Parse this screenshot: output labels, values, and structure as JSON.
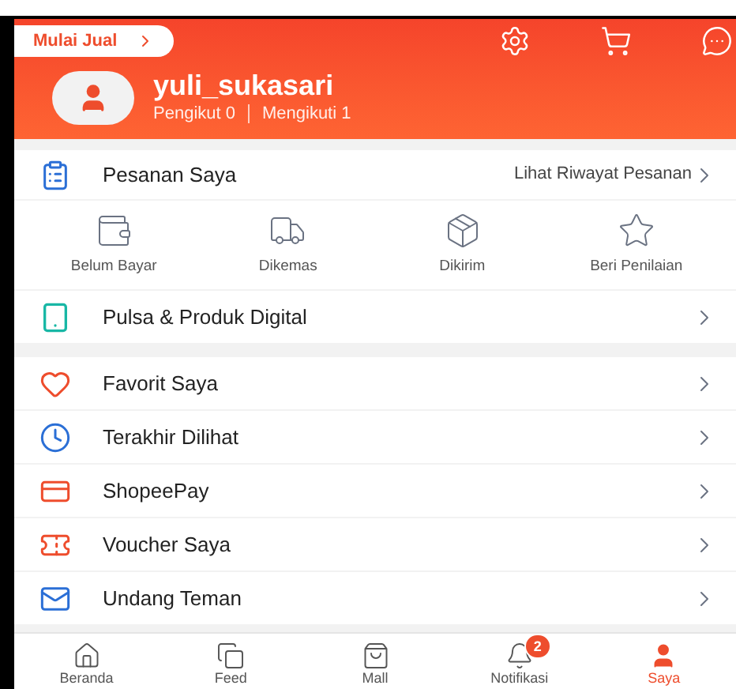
{
  "header": {
    "sell_button": "Mulai Jual",
    "username": "yuli_sukasari",
    "followers": "Pengikut 0",
    "following": "Mengikuti 1"
  },
  "orders": {
    "title": "Pesanan Saya",
    "history_link": "Lihat Riwayat Pesanan",
    "statuses": [
      "Belum Bayar",
      "Dikemas",
      "Dikirim",
      "Beri Penilaian"
    ]
  },
  "digital": {
    "label": "Pulsa & Produk Digital"
  },
  "menu": [
    "Favorit Saya",
    "Terakhir Dilihat",
    "ShopeePay",
    "Voucher Saya",
    "Undang Teman"
  ],
  "bottom_nav": [
    {
      "label": "Beranda",
      "selected": false
    },
    {
      "label": "Feed",
      "selected": false
    },
    {
      "label": "Mall",
      "selected": false
    },
    {
      "label": "Notifikasi",
      "selected": false,
      "badge": "2"
    },
    {
      "label": "Saya",
      "selected": true
    }
  ]
}
